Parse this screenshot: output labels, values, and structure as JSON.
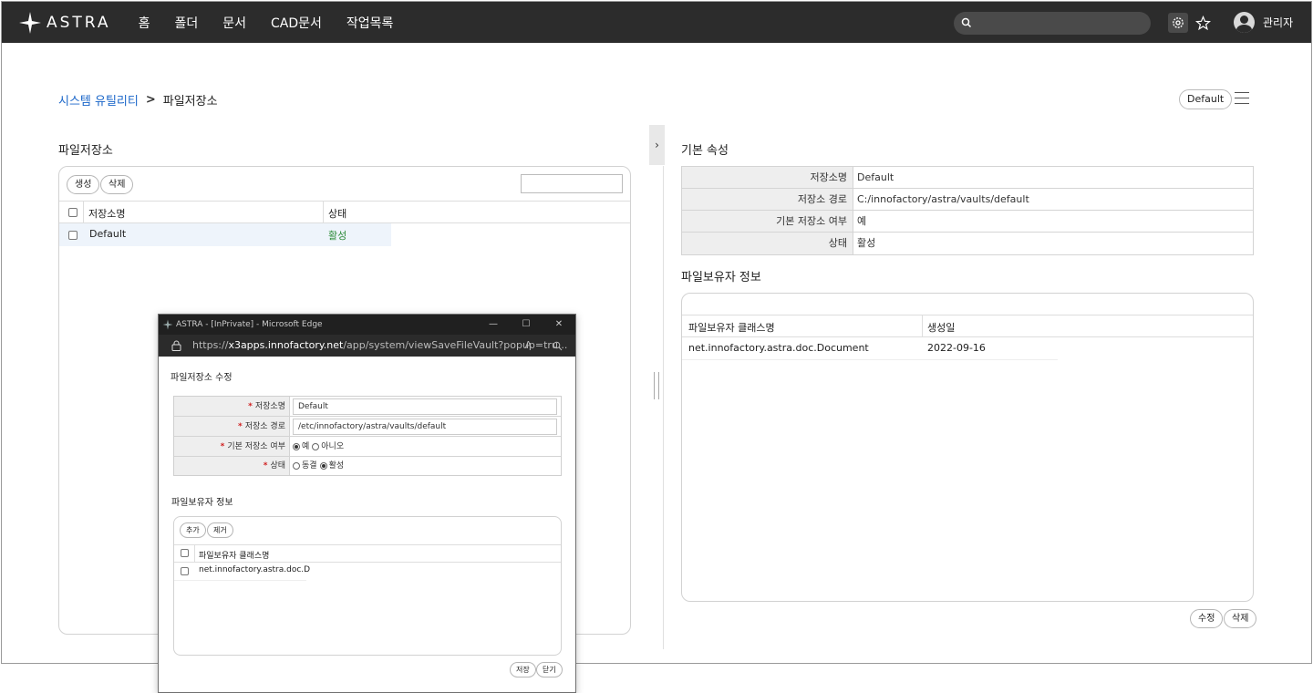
{
  "app": {
    "logo_text": "ASTRA"
  },
  "nav": {
    "items": [
      "홈",
      "폴더",
      "문서",
      "CAD문서",
      "작업목록"
    ],
    "user_name": "관리자"
  },
  "breadcrumb": {
    "parent": "시스템 유틸리티",
    "separator": ">",
    "current": "파일저장소"
  },
  "header_right": {
    "vault_pill": "Default"
  },
  "left": {
    "section_title": "파일저장소",
    "buttons": {
      "create": "생성",
      "delete": "삭제"
    },
    "columns": [
      "저장소명",
      "상태"
    ],
    "rows": [
      {
        "name": "Default",
        "status": "활성"
      }
    ]
  },
  "right": {
    "props_title": "기본 속성",
    "props": [
      {
        "label": "저장소명",
        "value": "Default"
      },
      {
        "label": "저장소 경로",
        "value": "C:/innofactory/astra/vaults/default"
      },
      {
        "label": "기본 저장소 여부",
        "value": "예"
      },
      {
        "label": "상태",
        "value": "활성"
      }
    ],
    "holder_title": "파일보유자 정보",
    "holder_columns": [
      "파일보유자 클래스명",
      "생성일"
    ],
    "holder_rows": [
      {
        "class": "net.innofactory.astra.doc.Document",
        "date": "2022-09-16"
      }
    ],
    "buttons": {
      "edit": "수정",
      "delete": "삭제"
    }
  },
  "popup": {
    "window_title": "ASTRA - [InPrivate] - Microsoft Edge",
    "url_prefix": "https://",
    "url_host": "x3apps.innofactory.net",
    "url_path": "/app/system/viewSaveFileVault?popup=tru...",
    "title": "파일저장소 수정",
    "fields": {
      "name_label": "저장소명",
      "name_value": "Default",
      "path_label": "저장소 경로",
      "path_value": "/etc/innofactory/astra/vaults/default",
      "default_label": "기본 저장소 여부",
      "default_yes": "예",
      "default_no": "아니오",
      "status_label": "상태",
      "status_frozen": "동결",
      "status_active": "활성"
    },
    "holder_title": "파일보유자 정보",
    "holder_buttons": {
      "add": "추가",
      "remove": "제거"
    },
    "holder_column": "파일보유자 클래스명",
    "holder_rows": [
      "net.innofactory.astra.doc.D"
    ],
    "footer_buttons": {
      "save": "저장",
      "close": "닫기"
    }
  },
  "colors": {
    "nav_bg": "#2c2c2c",
    "link": "#1a66c9",
    "active_status": "#2e8b3a",
    "required": "#d02020"
  }
}
